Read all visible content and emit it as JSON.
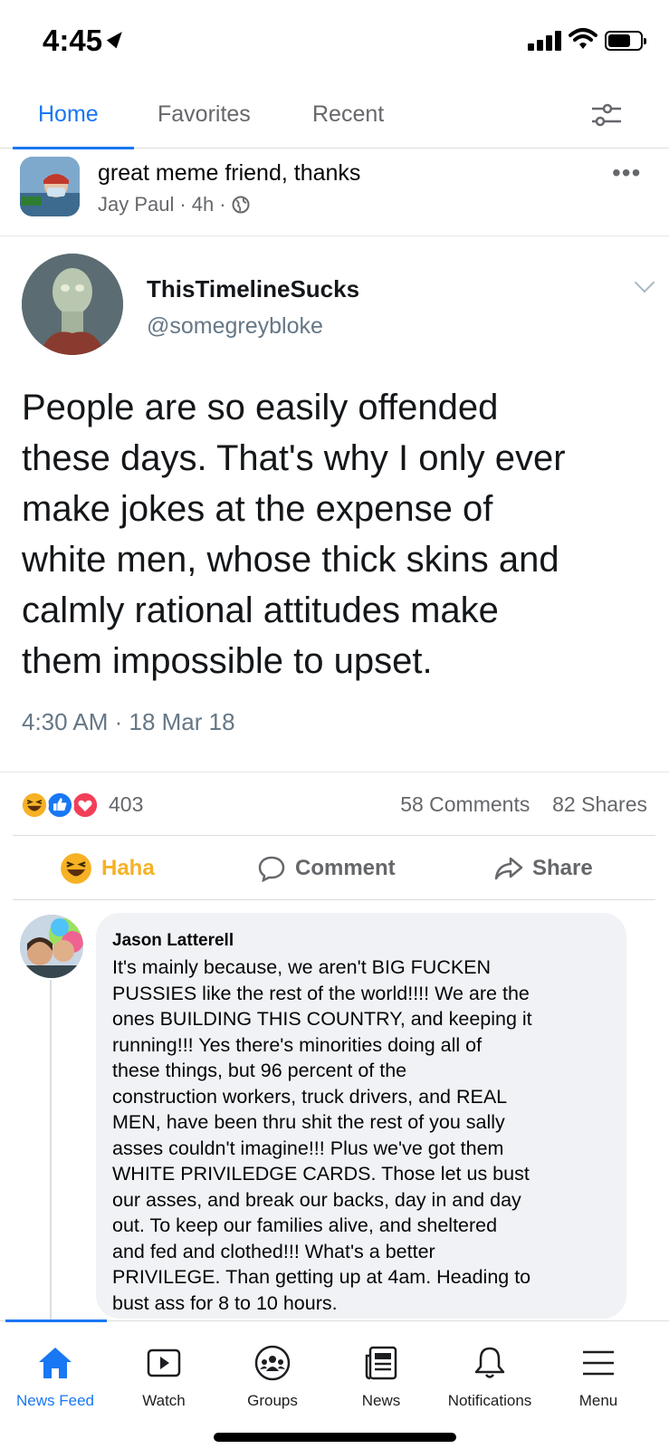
{
  "status_bar": {
    "time": "4:45"
  },
  "top_tabs": [
    {
      "label": "Home",
      "active": true
    },
    {
      "label": "Favorites",
      "active": false
    },
    {
      "label": "Recent",
      "active": false
    }
  ],
  "post": {
    "title": "great meme friend, thanks",
    "author": "Jay Paul",
    "age": "4h",
    "separator": "·",
    "privacy_icon": "globe-icon"
  },
  "tweet": {
    "name": "ThisTimelineSucks",
    "handle": "@somegreybloke",
    "text_lines": [
      "People are so easily offended",
      "these days. That's why I only ever",
      "make jokes at the expense of",
      "white men, whose thick skins and",
      "calmly rational attitudes make",
      "them impossible to upset."
    ],
    "timestamp": "4:30 AM · 18 Mar 18"
  },
  "reactions": {
    "count": "403",
    "comments": "58 Comments",
    "shares": "82 Shares",
    "icons": [
      "haha-icon",
      "like-icon",
      "love-icon"
    ]
  },
  "actions": {
    "haha": "Haha",
    "comment": "Comment",
    "share": "Share"
  },
  "comment": {
    "author": "Jason Latterell",
    "lines": [
      "It's mainly because, we aren't BIG FUCKEN",
      "PUSSIES like the rest of the world!!!! We are the",
      "ones BUILDING THIS COUNTRY, and keeping it",
      "running!!! Yes there's minorities doing all of",
      "these things, but 96 percent of the",
      "construction workers, truck drivers, and REAL",
      "MEN, have been thru shit the rest of you sally",
      "asses couldn't imagine!!! Plus we've got them",
      "WHITE PRIVILEDGE CARDS. Those let us bust",
      "our asses, and break our backs, day in and day",
      "out. To keep our families alive, and sheltered",
      "and fed and clothed!!! What's a better",
      "PRIVILEGE. Than getting up at 4am. Heading to",
      "bust ass for 8 to 10 hours."
    ]
  },
  "bottom_nav": [
    {
      "label": "News Feed",
      "icon": "home-icon",
      "active": true
    },
    {
      "label": "Watch",
      "icon": "watch-icon",
      "active": false
    },
    {
      "label": "Groups",
      "icon": "groups-icon",
      "active": false
    },
    {
      "label": "News",
      "icon": "news-icon",
      "active": false
    },
    {
      "label": "Notifications",
      "icon": "bell-icon",
      "active": false
    },
    {
      "label": "Menu",
      "icon": "menu-icon",
      "active": false
    }
  ],
  "colors": {
    "accent": "#1877f2",
    "haha": "#f7b125",
    "love": "#f33e58",
    "secondary_text": "#65676b"
  }
}
